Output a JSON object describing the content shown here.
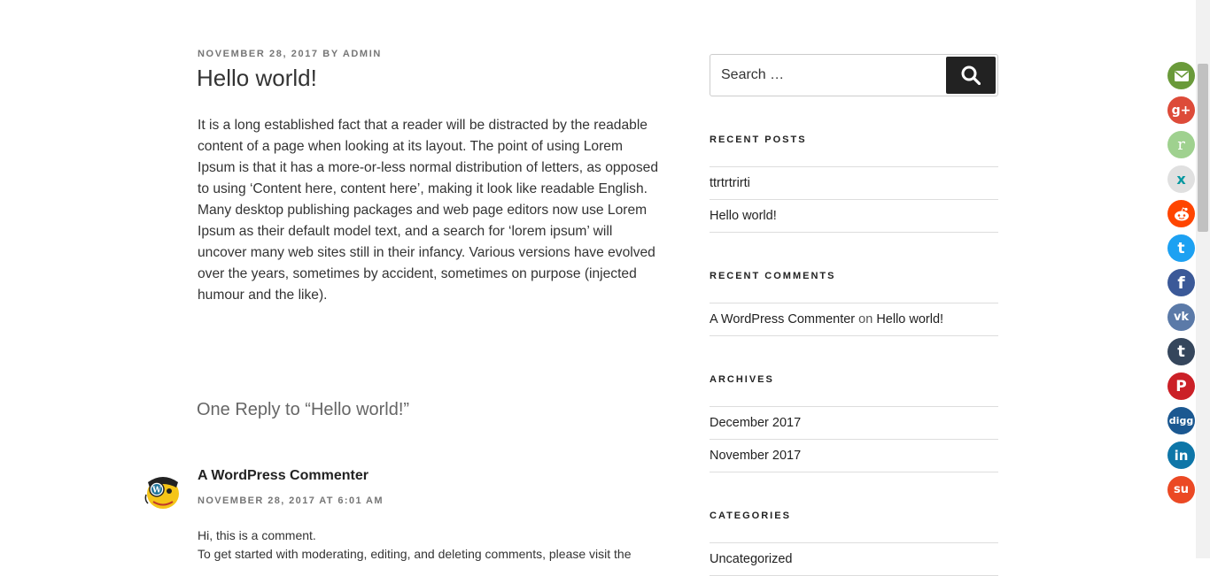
{
  "post": {
    "date": "November 28, 2017",
    "by": "by",
    "author": "admin",
    "title": "Hello world!",
    "body": "It is a long established fact that a reader will be distracted by the readable content of a page when looking at its layout. The point of using Lorem Ipsum is that it has a more-or-less normal distribution of letters, as opposed to using ‘Content here, content here’, making it look like readable English. Many desktop publishing packages and web page editors now use Lorem Ipsum as their default model text, and a search for ‘lorem ipsum’ will uncover many web sites still in their infancy. Various versions have evolved over the years, sometimes by accident, sometimes on purpose (injected humour and the like)."
  },
  "comments": {
    "heading": "One Reply to “Hello world!”",
    "items": [
      {
        "author": "A WordPress Commenter",
        "meta": "November 28, 2017 at 6:01 am",
        "line1": "Hi, this is a comment.",
        "line2": "To get started with moderating, editing, and deleting comments, please visit the"
      }
    ]
  },
  "sidebar": {
    "search": {
      "placeholder": "Search …"
    },
    "recent_posts": {
      "title": "Recent Posts",
      "items": [
        "ttrtrtrirti",
        "Hello world!"
      ]
    },
    "recent_comments": {
      "title": "Recent Comments",
      "items": [
        {
          "author": "A WordPress Commenter",
          "on": "on",
          "post": "Hello world!"
        }
      ]
    },
    "archives": {
      "title": "Archives",
      "items": [
        "December 2017",
        "November 2017"
      ]
    },
    "categories": {
      "title": "Categories",
      "items": [
        "Uncategorized"
      ]
    }
  },
  "social": [
    {
      "name": "email",
      "color": "#6a9a3a"
    },
    {
      "name": "google-plus",
      "color": "#dd4b39"
    },
    {
      "name": "renren",
      "color": "#9fd18f"
    },
    {
      "name": "xing",
      "color": "#4e6666"
    },
    {
      "name": "reddit",
      "color": "#ff4500"
    },
    {
      "name": "twitter",
      "color": "#1da1f2"
    },
    {
      "name": "facebook",
      "color": "#3b5998"
    },
    {
      "name": "vk",
      "color": "#5b7aa8"
    },
    {
      "name": "tumblr",
      "color": "#35465c"
    },
    {
      "name": "pinterest",
      "color": "#cb2027"
    },
    {
      "name": "digg",
      "color": "#1b5891"
    },
    {
      "name": "linkedin",
      "color": "#0e76a8"
    },
    {
      "name": "stumbleupon",
      "color": "#eb4924"
    }
  ],
  "social_labels": {
    "googleplus": "g+",
    "renren": "r",
    "xing": "x",
    "twitter": "t",
    "facebook": "f",
    "vk": "vk",
    "tumblr": "t",
    "pinterest": "P",
    "digg": "digg",
    "linkedin": "in",
    "stumbleupon": "su"
  }
}
